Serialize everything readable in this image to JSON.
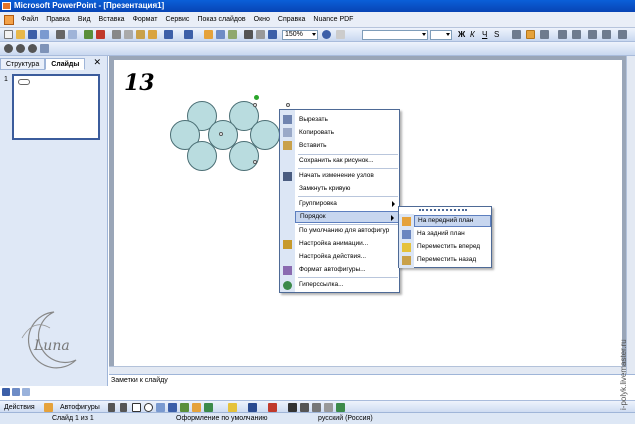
{
  "window": {
    "title": "Microsoft PowerPoint - [Презентация1]"
  },
  "menu": [
    "Файл",
    "Правка",
    "Вид",
    "Вставка",
    "Формат",
    "Сервис",
    "Показ слайдов",
    "Окно",
    "Справка",
    "Nuance PDF"
  ],
  "toolbar": {
    "zoom": "150%"
  },
  "panel": {
    "tabs": [
      "Структура",
      "Слайды"
    ],
    "close_glyph": "✕",
    "slide_number": "1"
  },
  "slide": {
    "label": "13"
  },
  "context_menu": {
    "items": [
      "Вырезать",
      "Копировать",
      "Вставить",
      "Сохранить как рисунок...",
      "Начать изменение узлов",
      "Замкнуть кривую",
      "Группировка",
      "Порядок",
      "По умолчанию для автофигур",
      "Настройка анимации...",
      "Настройка действия...",
      "Формат автофигуры...",
      "Гиперссылка..."
    ],
    "highlighted": "Порядок"
  },
  "order_submenu": {
    "items": [
      "На передний план",
      "На задний план",
      "Переместить вперед",
      "Переместить назад"
    ],
    "highlighted": "На передний план"
  },
  "notes": {
    "placeholder": "Заметки к слайду"
  },
  "drawing": {
    "actions": "Действия",
    "autoshapes": "Автофигуры"
  },
  "status": {
    "slide": "Слайд 1 из 1",
    "design": "Оформление по умолчанию",
    "language": "русский (Россия)"
  },
  "watermark": {
    "credit": "i-polyk.livemaster.ru"
  }
}
